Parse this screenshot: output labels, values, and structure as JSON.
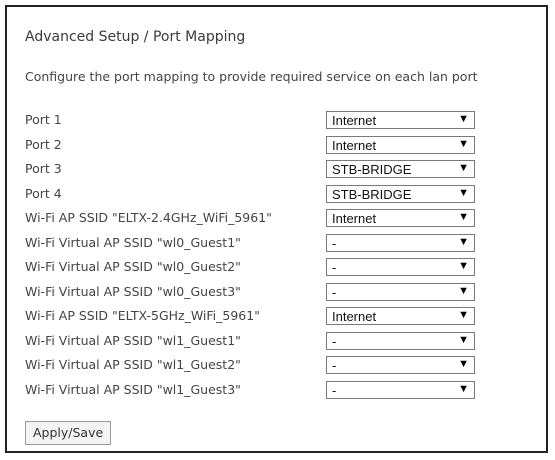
{
  "page": {
    "title": "Advanced Setup / Port Mapping",
    "description": "Configure the port mapping to provide required service on each lan port"
  },
  "rows": [
    {
      "label": "Port 1",
      "value": "Internet"
    },
    {
      "label": "Port 2",
      "value": "Internet"
    },
    {
      "label": "Port 3",
      "value": "STB-BRIDGE"
    },
    {
      "label": "Port 4",
      "value": "STB-BRIDGE"
    },
    {
      "label": "Wi-Fi AP SSID \"ELTX-2.4GHz_WiFi_5961\"",
      "value": "Internet"
    },
    {
      "label": "Wi-Fi Virtual AP SSID \"wl0_Guest1\"",
      "value": "-"
    },
    {
      "label": "Wi-Fi Virtual AP SSID \"wl0_Guest2\"",
      "value": "-"
    },
    {
      "label": "Wi-Fi Virtual AP SSID \"wl0_Guest3\"",
      "value": "-"
    },
    {
      "label": "Wi-Fi AP SSID \"ELTX-5GHz_WiFi_5961\"",
      "value": "Internet"
    },
    {
      "label": "Wi-Fi Virtual AP SSID \"wl1_Guest1\"",
      "value": "-"
    },
    {
      "label": "Wi-Fi Virtual AP SSID \"wl1_Guest2\"",
      "value": "-"
    },
    {
      "label": "Wi-Fi Virtual AP SSID \"wl1_Guest3\"",
      "value": "-"
    }
  ],
  "icons": {
    "dropdown_arrow": "▼",
    "dropdown_arrow_name": "dropdown-arrow-icon"
  },
  "actions": {
    "apply_save_label": "Apply/Save"
  }
}
